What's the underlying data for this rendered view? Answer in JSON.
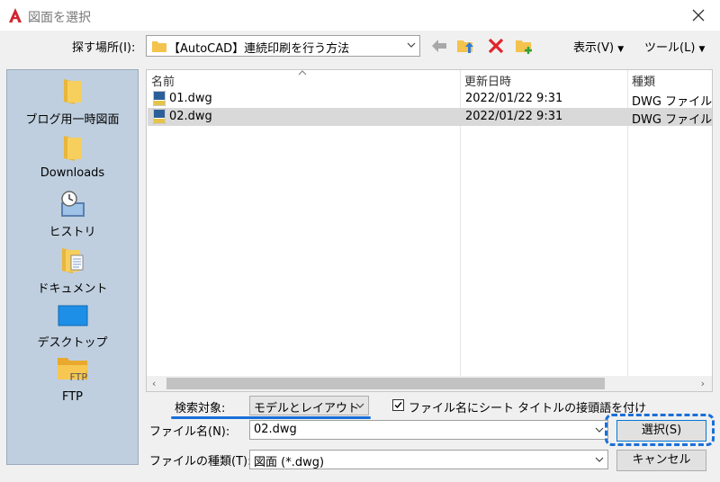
{
  "window": {
    "title": "図面を選択"
  },
  "lookin": {
    "label": "探す場所(I):",
    "value": "【AutoCAD】連続印刷を行う方法"
  },
  "menus": {
    "view": "表示(V)",
    "tools": "ツール(L)"
  },
  "places": [
    {
      "label": "ブログ用一時図面",
      "icon": "folder-icon"
    },
    {
      "label": "Downloads",
      "icon": "folder-icon"
    },
    {
      "label": "ヒストリ",
      "icon": "history-icon"
    },
    {
      "label": "ドキュメント",
      "icon": "documents-folder-icon"
    },
    {
      "label": "デスクトップ",
      "icon": "desktop-icon"
    },
    {
      "label": "FTP",
      "icon": "ftp-folder-icon",
      "badge": "FTP"
    }
  ],
  "filelist": {
    "columns": [
      "名前",
      "更新日時",
      "種類"
    ],
    "rows": [
      {
        "name": "01.dwg",
        "date": "2022/01/22 9:31",
        "type": "DWG ファイル",
        "selected": false
      },
      {
        "name": "02.dwg",
        "date": "2022/01/22 9:31",
        "type": "DWG ファイル",
        "selected": true
      }
    ]
  },
  "search": {
    "label": "検索対象:",
    "value": "モデルとレイアウト"
  },
  "prefix_checkbox": {
    "label": "ファイル名にシート タイトルの接頭語を付け",
    "checked": true
  },
  "filename": {
    "label": "ファイル名(N):",
    "value": "02.dwg"
  },
  "filetype": {
    "label": "ファイルの種類(T):",
    "value": "図面 (*.dwg)"
  },
  "buttons": {
    "select": "選択(S)",
    "cancel": "キャンセル"
  },
  "colors": {
    "highlight_blue": "#1a6fd8",
    "places_bg": "#bfcfdf",
    "autocad_red": "#d1242f"
  }
}
